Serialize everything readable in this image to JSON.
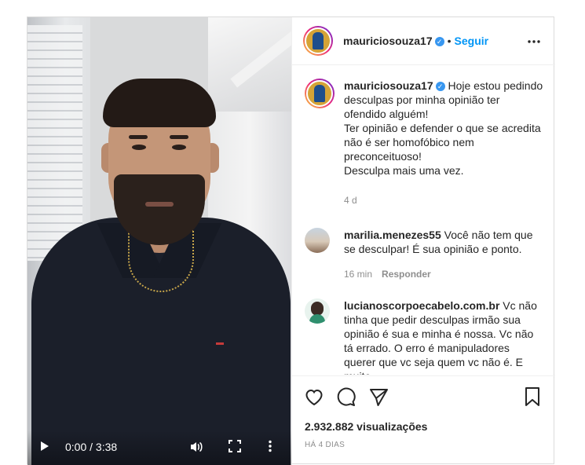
{
  "post": {
    "username": "mauriciosouza17",
    "follow_label": "Seguir",
    "separator": "•",
    "more_label": "•••"
  },
  "video": {
    "time": "0:00 / 3:38"
  },
  "caption": {
    "username": "mauriciosouza17",
    "text": "Hoje estou pedindo desculpas por minha opinião ter ofendido alguém!\nTer opinião e defender o que se acredita não é ser homofóbico nem preconceituoso!\nDesculpa mais uma vez.",
    "age": "4 d"
  },
  "comments": [
    {
      "username": "marilia.menezes55",
      "text": "Você não tem que se desculpar! É sua opinião e ponto.",
      "age": "16 min",
      "reply_label": "Responder"
    },
    {
      "username": "lucianoscorpoecabelo.com.br",
      "text": "Vc não tinha que pedir desculpas irmão sua opinião é sua e minha é nossa. Vc não tá errado. O erro é manipuladores querer que vc seja quem vc não é. E muito"
    }
  ],
  "stats": {
    "views": "2.932.882 visualizações",
    "posted": "HÁ 4 DIAS"
  },
  "icons": [
    "play-icon",
    "volume-icon",
    "fullscreen-icon",
    "more-vertical-icon",
    "verified-icon",
    "more-horizontal-icon",
    "heart-icon",
    "comment-icon",
    "share-icon",
    "bookmark-icon"
  ]
}
